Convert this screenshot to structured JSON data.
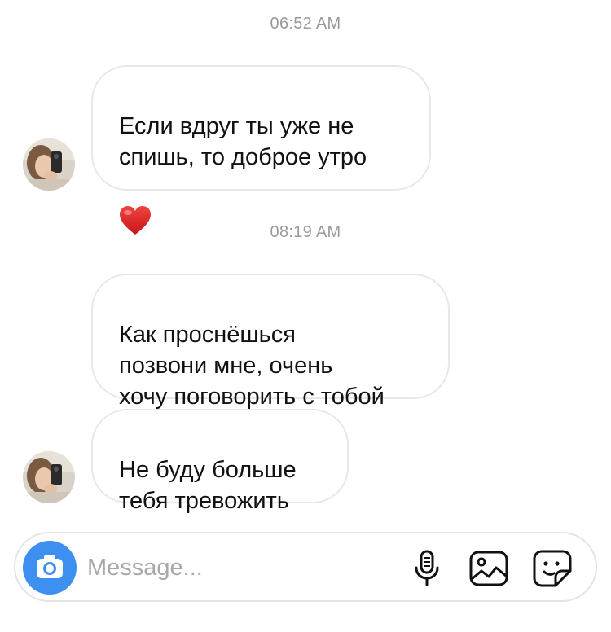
{
  "conversation": {
    "timestamps": [
      "06:52 AM",
      "08:19 AM"
    ],
    "messages": [
      {
        "text": "Если вдруг ты уже не\nспишь, то доброе утро",
        "emoji": "❤️"
      },
      {
        "text": "Как проснёшься\nпозвони мне, очень\nхочу поговорить с тобой"
      },
      {
        "text": "Не буду больше\nтебя тревожить"
      }
    ]
  },
  "composer": {
    "placeholder": "Message...",
    "icons": [
      "camera-icon",
      "microphone-icon",
      "gallery-icon",
      "sticker-icon"
    ],
    "camera_color": "#3d8ff0"
  },
  "colors": {
    "bubble_border": "#e8e8ea",
    "timestamp": "#9a9a9a",
    "heart": "#e5262b"
  }
}
